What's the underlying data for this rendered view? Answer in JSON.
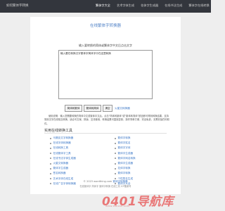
{
  "header": {
    "logo": "如何繁体字转换",
    "nav": [
      "繁体字大全",
      "艺术字体生成",
      "花体字生成器",
      "在线书法生成",
      "繁体字在线转换"
    ]
  },
  "main": {
    "title": "在线繁体字转换器",
    "prompt": "输入要转换的简体或繁体字中文后点击文字",
    "textarea_value": "输入要在转换汉字繁体字简体字中在这里转换",
    "buttons": [
      "简体转繁体",
      "繁体转简体"
    ],
    "clear_link": "清空",
    "fullscreen_link": "火星文转换器",
    "description": "使用说明：输入您需要转换的简体中文或繁体中文后，点击\"简体转繁体\"或\"繁体转简体\"按钮即可得到转换结果，支持常用汉字在线相互转换，适合写文案、排版、交流使用，转换结果可直接复制，操作简单方便，完全免费，无需安装任何软件。"
  },
  "tools": {
    "section_title": "实用在线转换工具",
    "left": [
      "马赛克文字转换器",
      "在线字体转换器",
      "在线转换工具",
      "在线繁体字工具",
      "在线书法字体生成器",
      "火星文转换器",
      "繁体字生成器",
      "签名转换器",
      "艺术字体在线生成",
      "在线广告字体转换器"
    ],
    "right": [
      "繁体字转换",
      "繁体字姓名",
      "繁体字字体",
      "繁体字生成器",
      "繁体字网名转换",
      "繁体字生成器",
      "花体字转换",
      "繁体字转换",
      "个性签名生成",
      "繁体字大全"
    ]
  },
  "footer": {
    "line1_prefix": "© 2023 wordthing.com",
    "line1_link": "繁体字转换器",
    "line2": "在线繁体字 简体字 繁体字转换 在线工具 ICP备案号"
  },
  "watermark": {
    "main": "0401导航库",
    "sub": "WWW.0401DH.COM"
  },
  "colors": {
    "topbar": "#33363d",
    "accent": "#3a76c6",
    "watermark": "#e96b6b"
  }
}
